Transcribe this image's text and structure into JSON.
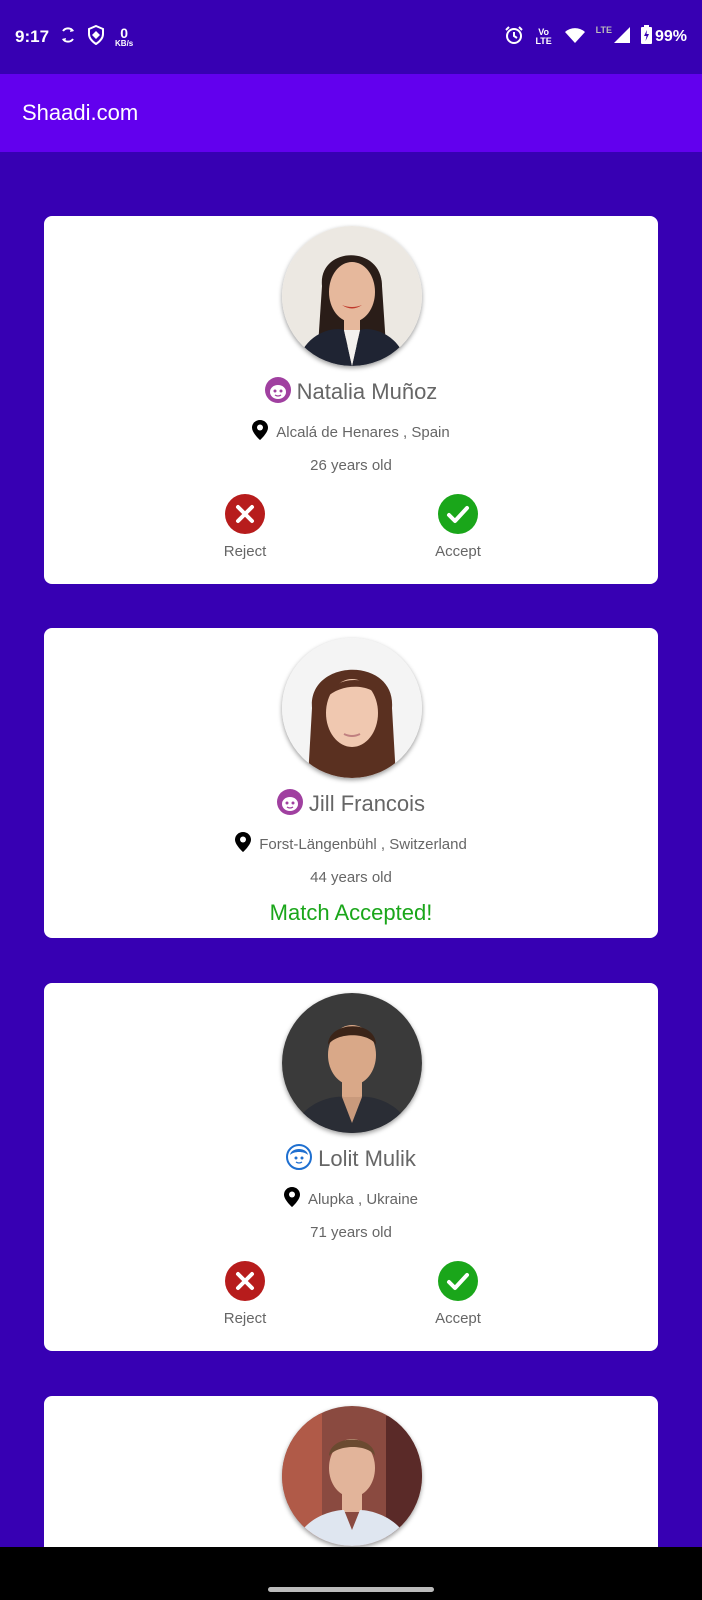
{
  "status_bar": {
    "time": "9:17",
    "net_speed_value": "0",
    "net_speed_unit": "KB/s",
    "volte_label": "Vo LTE",
    "lte_label": "LTE",
    "battery": "99%",
    "icons": [
      "sync-icon",
      "shield-icon",
      "alarm-icon",
      "wifi-icon",
      "signal-icon",
      "battery-icon"
    ]
  },
  "app_bar": {
    "title": "Shaadi.com"
  },
  "colors": {
    "primary_dark": "#3700b3",
    "primary": "#6200ee",
    "reject_red": "#b71c1c",
    "accept_green": "#1aa61a",
    "female_icon": "#a040a0",
    "male_icon": "#1e6fd0"
  },
  "cards": [
    {
      "name": "Natalia Muñoz",
      "gender_icon": "female-face-icon",
      "location": "Alcalá de Henares , Spain",
      "age": "26 years old",
      "reject_label": "Reject",
      "accept_label": "Accept"
    },
    {
      "name": "Jill Francois",
      "gender_icon": "female-face-icon",
      "location": "Forst-Längenbühl , Switzerland",
      "age": "44 years old",
      "status": "Match Accepted!"
    },
    {
      "name": "Lolit Mulik",
      "gender_icon": "male-face-icon",
      "location": "Alupka , Ukraine",
      "age": "71 years old",
      "reject_label": "Reject",
      "accept_label": "Accept"
    }
  ]
}
